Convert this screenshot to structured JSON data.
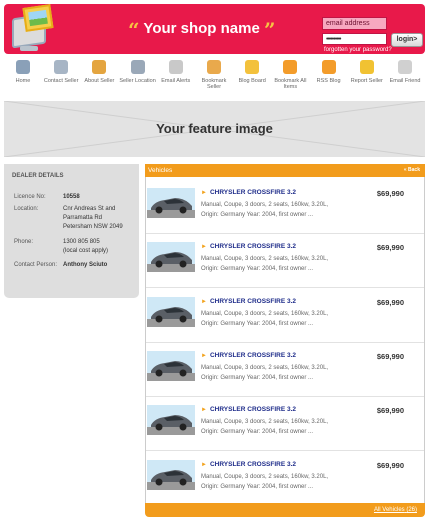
{
  "header": {
    "shop_name": "Your shop name",
    "open_quote": "“",
    "close_quote": "”",
    "email_placeholder": "email address",
    "password_value": "••••••••••",
    "login_label": "login>",
    "forgot_label": "forgotten your password?",
    "brand_color": "#e8194a"
  },
  "nav": {
    "items": [
      {
        "label": "Home",
        "icon": "home-icon",
        "color": "#8aa0b8"
      },
      {
        "label": "Contact Seller",
        "icon": "chat-icon",
        "color": "#a7b5c5"
      },
      {
        "label": "About Seller",
        "icon": "user-icon",
        "color": "#e4a540"
      },
      {
        "label": "Seller Location",
        "icon": "globe-icon",
        "color": "#9aa8b8"
      },
      {
        "label": "Email Alerts",
        "icon": "rss-icon",
        "color": "#c9c9c9"
      },
      {
        "label": "Bookmark Seller",
        "icon": "bookmark-icon",
        "color": "#e9a94c"
      },
      {
        "label": "Blog Board",
        "icon": "note-icon",
        "color": "#f3c13c"
      },
      {
        "label": "Bookmark All Items",
        "icon": "rss-box-icon",
        "color": "#f39c2a"
      },
      {
        "label": "RSS Blog",
        "icon": "rss-box-icon",
        "color": "#f39c2a"
      },
      {
        "label": "Report Seller",
        "icon": "lightbulb-icon",
        "color": "#f1c232"
      },
      {
        "label": "Email Friend",
        "icon": "envelope-icon",
        "color": "#d0d0d0"
      }
    ]
  },
  "feature": {
    "label": "Your feature image"
  },
  "dealer": {
    "title": "DEALER DETAILS",
    "licence_label": "Licence No:",
    "licence_value": "10558",
    "location_label": "Location:",
    "location_l1": "Cnr Andreas St and",
    "location_l2": "Parramatta Rd",
    "location_l3": "Petersham NSW 2049",
    "phone_label": "Phone:",
    "phone_l1": "1300 805 805",
    "phone_l2": "(local cost apply)",
    "contact_label": "Contact Person:",
    "contact_value": "Anthony Sciuto"
  },
  "vehicles": {
    "title": "Vehicles",
    "back_label": "« Back",
    "all_label": "All Vehicles",
    "all_count": "(26)",
    "accent": "#f29c1c",
    "items": [
      {
        "title": "CHRYSLER CROSSFIRE 3.2",
        "line1": "Manual, Coupe, 3 doors, 2 seats, 160kw, 3.20L,",
        "line2": "Origin: Germany  Year: 2004, first owner ...",
        "price": "$69,990"
      },
      {
        "title": "CHRYSLER CROSSFIRE 3.2",
        "line1": "Manual, Coupe, 3 doors, 2 seats, 160kw, 3.20L,",
        "line2": "Origin: Germany  Year: 2004, first owner ...",
        "price": "$69,990"
      },
      {
        "title": "CHRYSLER CROSSFIRE 3.2",
        "line1": "Manual, Coupe, 3 doors, 2 seats, 160kw, 3.20L,",
        "line2": "Origin: Germany  Year: 2004, first owner ...",
        "price": "$69,990"
      },
      {
        "title": "CHRYSLER CROSSFIRE 3.2",
        "line1": "Manual, Coupe, 3 doors, 2 seats, 160kw, 3.20L,",
        "line2": "Origin: Germany  Year: 2004, first owner ...",
        "price": "$69,990"
      },
      {
        "title": "CHRYSLER CROSSFIRE 3.2",
        "line1": "Manual, Coupe, 3 doors, 2 seats, 160kw, 3.20L,",
        "line2": "Origin: Germany  Year: 2004, first owner ...",
        "price": "$69,990"
      },
      {
        "title": "CHRYSLER CROSSFIRE 3.2",
        "line1": "Manual, Coupe, 3 doors, 2 seats, 160kw, 3.20L,",
        "line2": "Origin: Germany  Year: 2004, first owner ...",
        "price": "$69,990"
      }
    ]
  }
}
